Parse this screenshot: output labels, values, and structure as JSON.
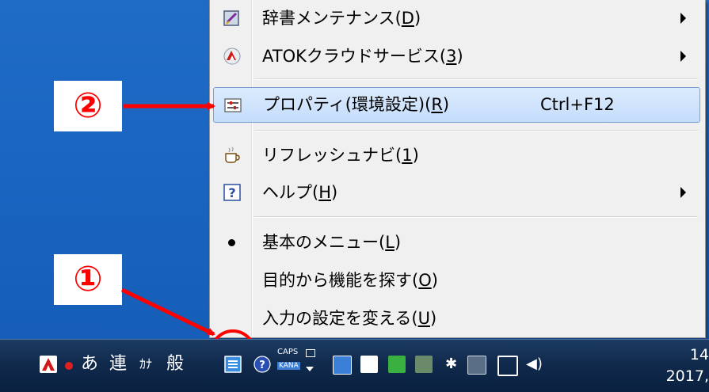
{
  "menu": {
    "items": [
      {
        "label": "辞書メンテナンス(",
        "key": "D",
        "suffix": ")",
        "submenu": true
      },
      {
        "label": "ATOKクラウドサービス(",
        "key": "3",
        "suffix": ")",
        "submenu": true
      },
      {
        "label": "プロパティ(環境設定)(",
        "key": "R",
        "suffix": ")",
        "accelerator": "Ctrl+F12",
        "highlighted": true
      },
      {
        "label": "リフレッシュナビ(",
        "key": "1",
        "suffix": ")"
      },
      {
        "label": "ヘルプ(",
        "key": "H",
        "suffix": ")",
        "submenu": true
      },
      {
        "label": "基本のメニュー(",
        "key": "L",
        "suffix": ")",
        "bullet": true
      },
      {
        "label": "目的から機能を探す(",
        "key": "O",
        "suffix": ")"
      },
      {
        "label": "入力の設定を変える(",
        "key": "U",
        "suffix": ")"
      }
    ]
  },
  "callouts": {
    "step1": "①",
    "step2": "②"
  },
  "taskbar": {
    "ime_hiragana": "あ",
    "ime_ren": "連",
    "ime_kana": "ｶﾅ",
    "ime_mode": "般",
    "caps_label": "CAPS",
    "kana_label": "KANA",
    "clock_time": "14",
    "clock_date": "2017,"
  },
  "colors": {
    "callout_red": "#ff0000",
    "highlight": "#c4ddfc",
    "desktop": "#1a66c2"
  },
  "icons": [
    "atok-dictionary-icon",
    "atok-cloud-icon",
    "properties-icon",
    "coffee-cup-icon",
    "help-icon",
    "bullet-icon"
  ]
}
